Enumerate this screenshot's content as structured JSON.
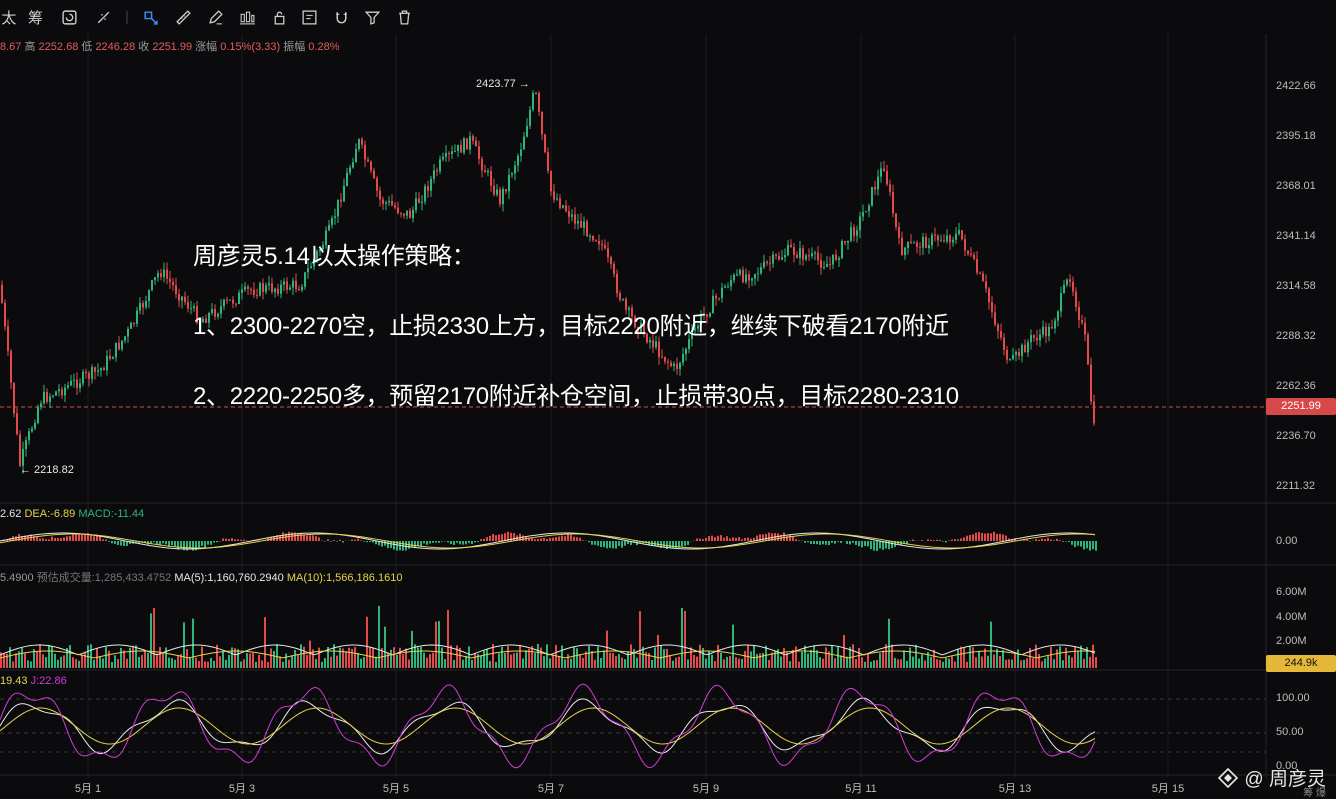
{
  "toolbar": {
    "items": [
      {
        "name": "partial-char",
        "label": "太"
      },
      {
        "name": "chip-tool",
        "label": "筹"
      },
      {
        "name": "refresh-icon",
        "label": ""
      },
      {
        "name": "indicator-tool-icon",
        "label": ""
      },
      {
        "name": "crosshair-select-icon",
        "label": ""
      },
      {
        "name": "ruler-icon",
        "label": ""
      },
      {
        "name": "pen-icon",
        "label": ""
      },
      {
        "name": "candle-icon",
        "label": ""
      },
      {
        "name": "lock-icon",
        "label": ""
      },
      {
        "name": "note-icon",
        "label": ""
      },
      {
        "name": "magnet-icon",
        "label": ""
      },
      {
        "name": "filter-icon",
        "label": ""
      },
      {
        "name": "trash-icon",
        "label": ""
      }
    ]
  },
  "ohlc": {
    "open": "8.67",
    "high_label": "高",
    "high": "2252.68",
    "low_label": "低",
    "low": "2246.28",
    "close_label": "收",
    "close": "2251.99",
    "change_label": "涨幅",
    "change": "0.15%(3.33)",
    "amp_label": "振幅",
    "amp": "0.28%"
  },
  "annotations": {
    "high_marker": "2423.77 →",
    "low_marker": "← 2218.82"
  },
  "strategy": {
    "title": "周彦灵5.14以太操作策略：",
    "line1": "1、2300-2270空，止损2330上方，目标2220附近，继续下破看2170附近",
    "line2": "2、2220-2250多，预留2170附近补仓空间，止损带30点，目标2280-2310"
  },
  "macd": {
    "dif": "2.62",
    "dea_label": "DEA:",
    "dea": "-6.89",
    "macd_label": "MACD:",
    "macd": "-11.44",
    "zero": "0.00"
  },
  "volume": {
    "vol": "5.4900",
    "est_label": "预估成交量:",
    "est": "1,285,433.4752",
    "ma5_label": "MA(5):",
    "ma5": "1,160,760.2940",
    "ma10_label": "MA(10):",
    "ma10": "1,566,186.1610",
    "ticks": [
      "6.00M",
      "4.00M",
      "2.00M"
    ],
    "current": "244.9k"
  },
  "kdj": {
    "d": "19.43",
    "j_label": "J:",
    "j": "22.86",
    "ticks": [
      "100.00",
      "50.00",
      "0.00"
    ]
  },
  "price_axis": {
    "ticks": [
      "2422.66",
      "2395.18",
      "2368.01",
      "2341.14",
      "2314.58",
      "2288.32",
      "2262.36",
      "2236.70",
      "2211.32"
    ],
    "current": "2251.99"
  },
  "time_axis": {
    "ticks": [
      "5月 1",
      "5月 3",
      "5月 5",
      "5月 7",
      "5月 9",
      "5月 11",
      "5月 13",
      "5月 15"
    ]
  },
  "watermark": {
    "text": "@ 周彦灵",
    "corner": "筹 爆"
  },
  "colors": {
    "up": "#2fb57c",
    "down": "#e14b4b",
    "background": "#0b0b0d",
    "accent": "#3d8bfd",
    "yellow": "#e6d34a",
    "magenta": "#d13bd8"
  }
}
